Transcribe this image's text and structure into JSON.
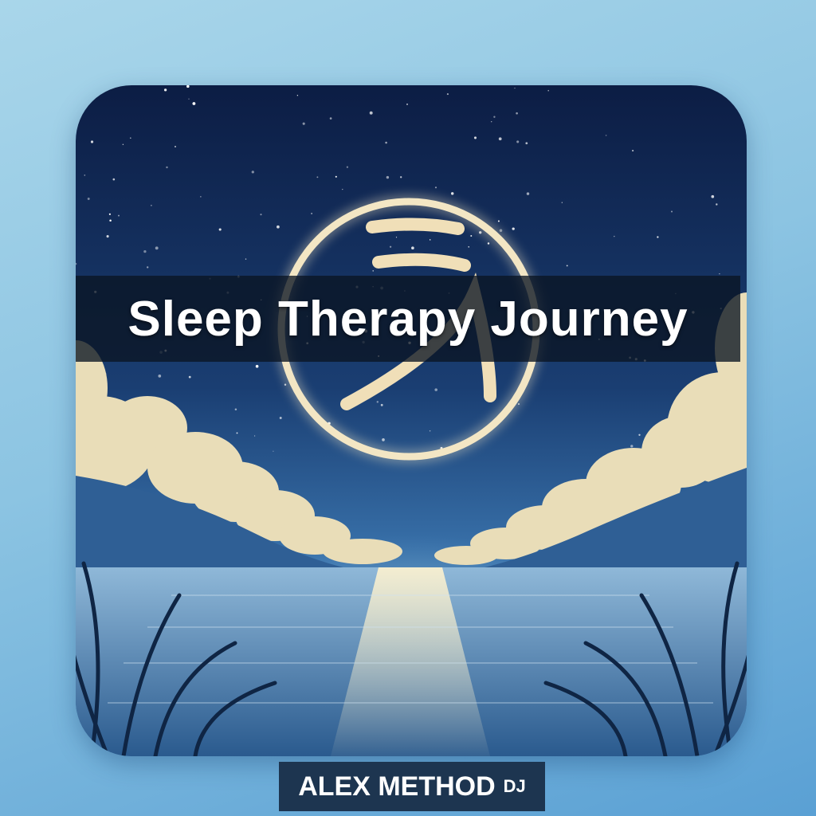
{
  "cover": {
    "title": "Sleep Therapy Journey",
    "emblem": "glowing-circle-glyph-icon"
  },
  "artist": {
    "name": "ALEX METHOD",
    "suffix": "DJ"
  },
  "colors": {
    "background": "#8cc4e2",
    "sky_top": "#0c1d44",
    "sky_bottom": "#3f7cb6",
    "glow": "#f3e6c4",
    "title_band": "#0a1423",
    "badge": "#1d3550"
  }
}
